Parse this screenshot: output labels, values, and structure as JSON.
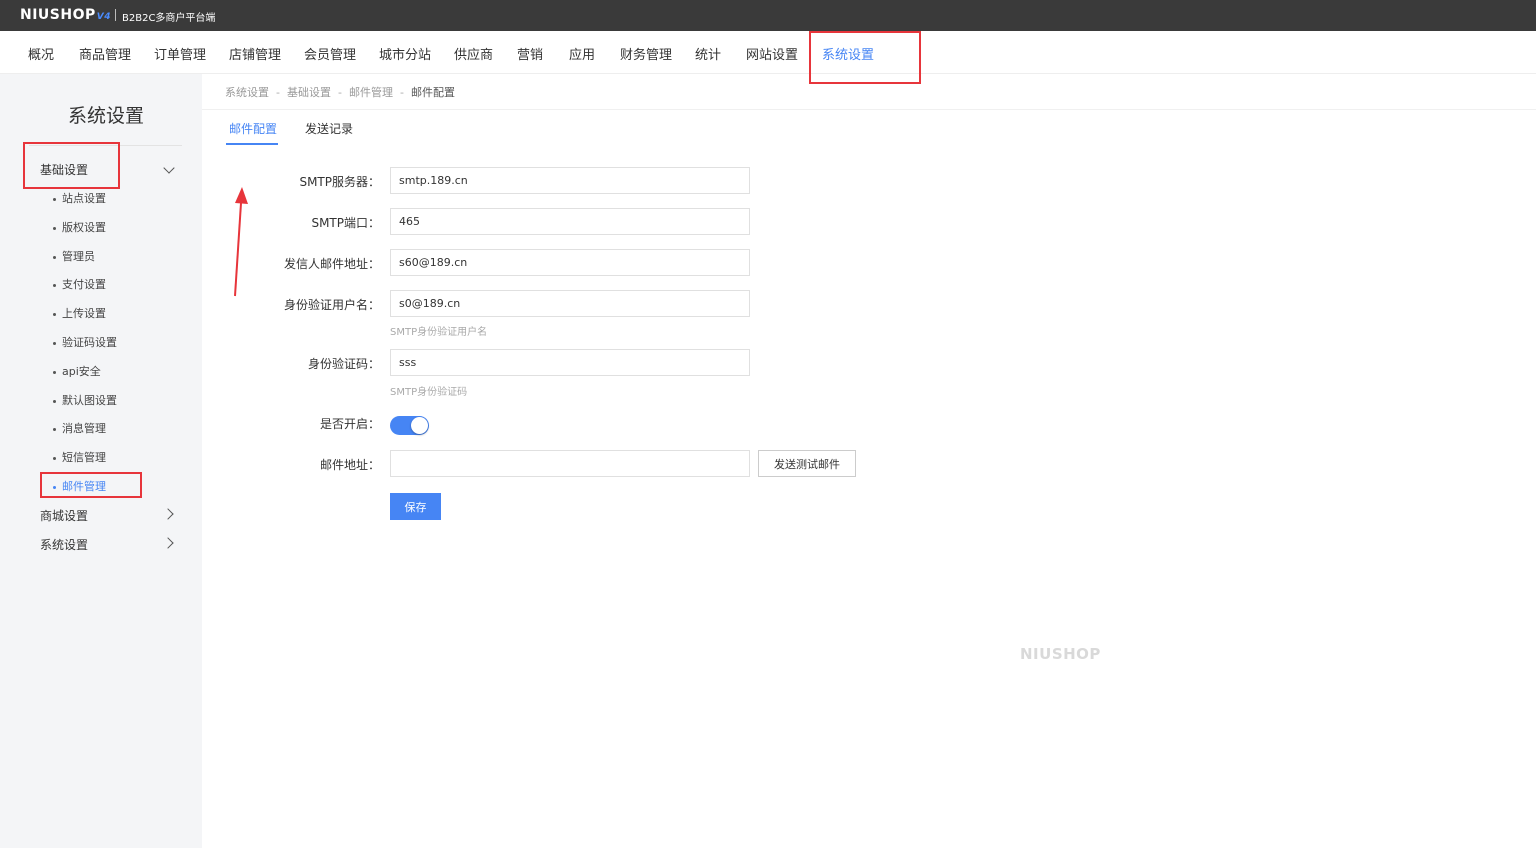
{
  "header": {
    "logo": "NIUSHOP",
    "logo_version": "V4",
    "platform": "B2B2C多商户平台端"
  },
  "nav": {
    "items": [
      "概况",
      "商品管理",
      "订单管理",
      "店铺管理",
      "会员管理",
      "城市分站",
      "供应商",
      "营销",
      "应用",
      "财务管理",
      "统计",
      "网站设置",
      "系统设置"
    ],
    "active": "系统设置"
  },
  "sidebar": {
    "title": "系统设置",
    "groups": [
      {
        "label": "基础设置",
        "expanded": true,
        "items": [
          "站点设置",
          "版权设置",
          "管理员",
          "支付设置",
          "上传设置",
          "验证码设置",
          "api安全",
          "默认图设置",
          "消息管理",
          "短信管理",
          "邮件管理"
        ],
        "active_item": "邮件管理"
      },
      {
        "label": "商城设置",
        "expanded": false
      },
      {
        "label": "系统设置",
        "expanded": false
      }
    ]
  },
  "breadcrumb": [
    "系统设置",
    "基础设置",
    "邮件管理",
    "邮件配置"
  ],
  "tabs": [
    "邮件配置",
    "发送记录"
  ],
  "active_tab": "邮件配置",
  "form": {
    "smtp_server": {
      "label": "SMTP服务器：",
      "value": "smtp.189.cn"
    },
    "smtp_port": {
      "label": "SMTP端口：",
      "value": "465"
    },
    "sender": {
      "label": "发信人邮件地址：",
      "value": "s60@189.cn"
    },
    "auth_user": {
      "label": "身份验证用户名：",
      "value": "s0@189.cn",
      "hint": "SMTP身份验证用户名"
    },
    "auth_code": {
      "label": "身份验证码：",
      "value": "sss",
      "hint": "SMTP身份验证码"
    },
    "enabled": {
      "label": "是否开启：",
      "value": true
    },
    "test_email": {
      "label": "邮件地址：",
      "value": "",
      "button": "发送测试邮件"
    },
    "save_button": "保存"
  },
  "watermark": "NIUSHOP",
  "colors": {
    "accent": "#4685f4",
    "topbar": "#3a3a3a",
    "highlight_box": "#e7353b",
    "arrow": "#e7353b",
    "sidebar_bg": "#f4f5f7"
  }
}
